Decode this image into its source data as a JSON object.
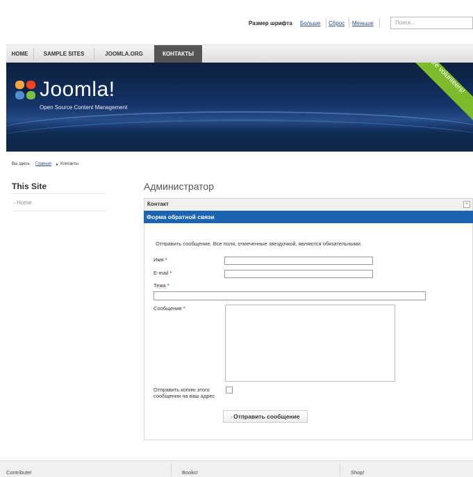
{
  "topbar": {
    "font_size_label": "Размер шрифта",
    "bigger": "Больше",
    "reset": "Сброс",
    "smaller": "Меньше",
    "search_placeholder": "Поиск..."
  },
  "nav": {
    "items": [
      {
        "label": "HOME"
      },
      {
        "label": "SAMPLE SITES"
      },
      {
        "label": "JOOMLA.ORG"
      },
      {
        "label": "КОНТАКТЫ"
      }
    ]
  },
  "banner": {
    "logo": "Joomla!",
    "tagline": "Open Source Content Management",
    "ribbon": "We are volunteers!"
  },
  "breadcrumb": {
    "prefix": "Вы здесь:",
    "home": "Главная",
    "separator": "▸",
    "current": "Контакты"
  },
  "sidebar": {
    "title": "This Site",
    "items": [
      {
        "label": "Home"
      }
    ]
  },
  "main": {
    "heading": "Администратор",
    "contact_header": "Контакт",
    "plus": "+",
    "form_title": "Форма обратной связи",
    "intro": "Отправить сообщение. Все поля, отмеченные звездочкой, являются обязательными.",
    "fields": {
      "name": "Имя",
      "email": "E-mail",
      "subject": "Тема",
      "message": "Сообщение",
      "copy": "Отправить копию этого сообщения на ваш адрес",
      "required_mark": "*"
    },
    "submit": "Отправить сообщение"
  },
  "footer": {
    "items": [
      {
        "label": "Contribute!"
      },
      {
        "label": "Books!"
      },
      {
        "label": "Shop!"
      }
    ]
  },
  "colors": {
    "nav_active": "#555555",
    "form_header": "#1b64b2",
    "banner_dark": "#0d1f3d",
    "ribbon": "#7dba2c"
  }
}
